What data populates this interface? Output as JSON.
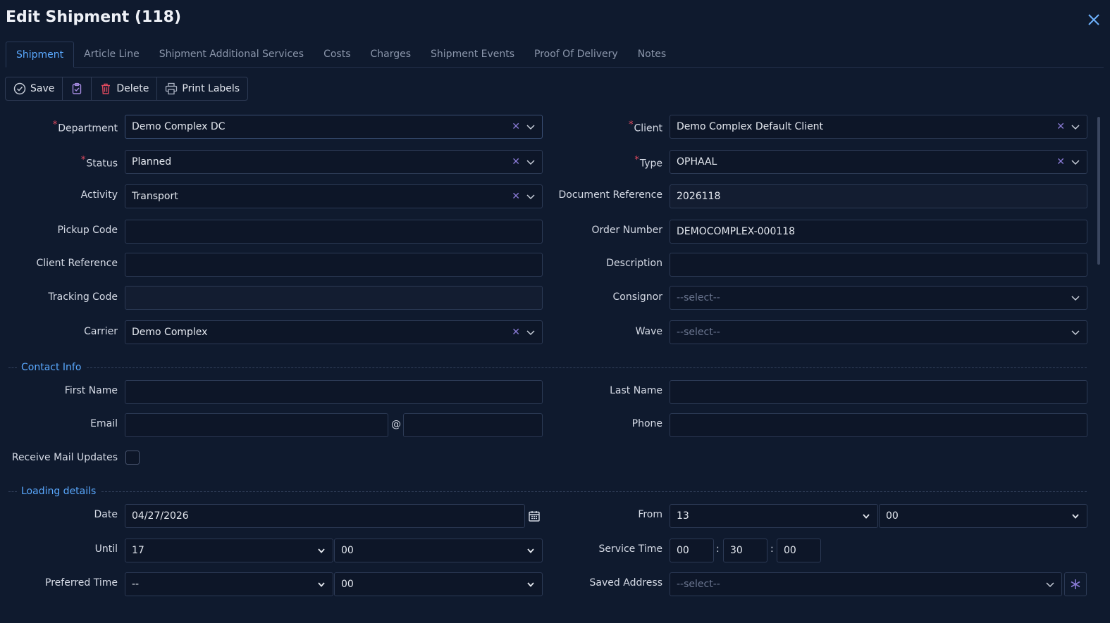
{
  "window": {
    "title": "Edit Shipment (118)"
  },
  "tabs": [
    "Shipment",
    "Article Line",
    "Shipment Additional Services",
    "Costs",
    "Charges",
    "Shipment Events",
    "Proof Of Delivery",
    "Notes"
  ],
  "toolbar": {
    "save": "Save",
    "delete": "Delete",
    "print_labels": "Print Labels"
  },
  "form": {
    "department": {
      "label": "Department",
      "value": "Demo Complex DC"
    },
    "client": {
      "label": "Client",
      "value": "Demo Complex Default Client"
    },
    "status": {
      "label": "Status",
      "value": "Planned"
    },
    "type": {
      "label": "Type",
      "value": "OPHAAL"
    },
    "activity": {
      "label": "Activity",
      "value": "Transport"
    },
    "document_reference": {
      "label": "Document Reference",
      "value": "2026118"
    },
    "pickup_code": {
      "label": "Pickup Code",
      "value": ""
    },
    "order_number": {
      "label": "Order Number",
      "value": "DEMOCOMPLEX-000118"
    },
    "client_reference": {
      "label": "Client Reference",
      "value": ""
    },
    "description": {
      "label": "Description",
      "value": ""
    },
    "tracking_code": {
      "label": "Tracking Code",
      "value": ""
    },
    "consignor": {
      "label": "Consignor",
      "placeholder": "--select--"
    },
    "carrier": {
      "label": "Carrier",
      "value": "Demo Complex"
    },
    "wave": {
      "label": "Wave",
      "placeholder": "--select--"
    }
  },
  "contact": {
    "section": "Contact Info",
    "first_name": {
      "label": "First Name",
      "value": ""
    },
    "last_name": {
      "label": "Last Name",
      "value": ""
    },
    "email": {
      "label": "Email",
      "at": "@"
    },
    "phone": {
      "label": "Phone",
      "value": ""
    },
    "receive_mail": {
      "label": "Receive Mail Updates",
      "checked": false
    }
  },
  "loading": {
    "section": "Loading details",
    "date": {
      "label": "Date",
      "value": "04/27/2026"
    },
    "from": {
      "label": "From",
      "hour": "13",
      "minute": "00"
    },
    "until": {
      "label": "Until",
      "hour": "17",
      "minute": "00"
    },
    "service_time": {
      "label": "Service Time",
      "h": "00",
      "m": "30",
      "s": "00",
      "sep": ":"
    },
    "preferred_time": {
      "label": "Preferred Time",
      "hour": "--",
      "minute": "00"
    },
    "saved_address": {
      "label": "Saved Address",
      "placeholder": "--select--"
    }
  },
  "colors": {
    "background": "#0f1a2e",
    "accent": "#5aa9ff",
    "required": "#e04a5f",
    "clear": "#8a7bd6"
  }
}
